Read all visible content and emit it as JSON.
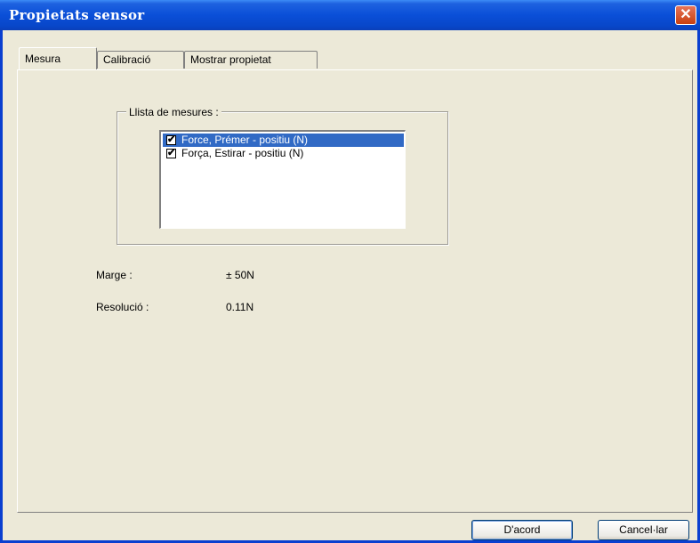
{
  "window": {
    "title": "Propietats sensor",
    "close_glyph": "✕"
  },
  "tabs": [
    {
      "label": "Mesura",
      "active": true
    },
    {
      "label": "Calibració",
      "active": false
    },
    {
      "label": "Mostrar propietat",
      "active": false
    }
  ],
  "measures": {
    "group_label": "Llista de mesures :",
    "items": [
      {
        "label": "Force, Prémer - positiu (N)",
        "checked": true,
        "selected": true
      },
      {
        "label": "Força, Estirar - positiu (N)",
        "checked": true,
        "selected": false
      }
    ]
  },
  "fields": {
    "range_label": "Marge :",
    "range_value": "± 50N",
    "resolution_label": "Resolució :",
    "resolution_value": "0.11N"
  },
  "buttons": {
    "ok_label": "D'acord",
    "cancel_label": "Cancel·lar"
  },
  "checkmark_glyph": "✔"
}
